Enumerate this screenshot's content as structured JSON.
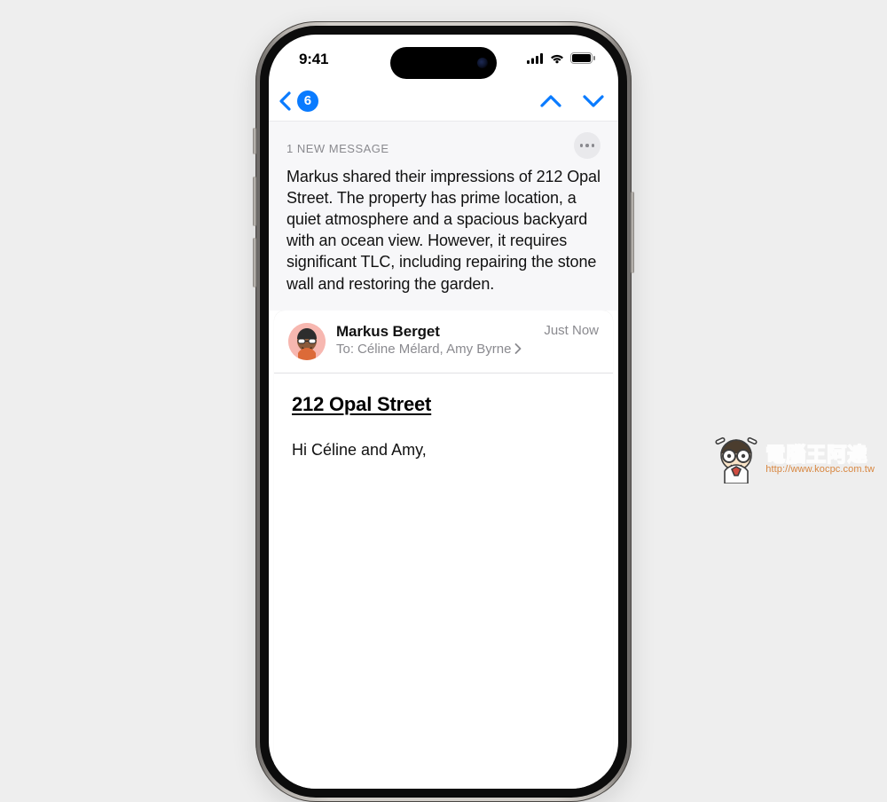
{
  "status": {
    "time": "9:41"
  },
  "nav": {
    "unread_count": "6"
  },
  "summary": {
    "label": "1 NEW MESSAGE",
    "text": "Markus shared their impressions of 212 Opal Street. The property has prime location, a quiet atmosphere and a spacious backyard with an ocean view. However, it requires significant TLC, including repairing the stone wall and restoring the garden."
  },
  "message": {
    "sender": "Markus Berget",
    "to_label": "To:",
    "recipients": "Céline Mélard, Amy Byrne",
    "timestamp": "Just Now",
    "subject": "212 Opal Street",
    "body_greeting": "Hi Céline and Amy,"
  },
  "watermark": {
    "title": "電腦王阿達",
    "url": "http://www.kocpc.com.tw"
  }
}
